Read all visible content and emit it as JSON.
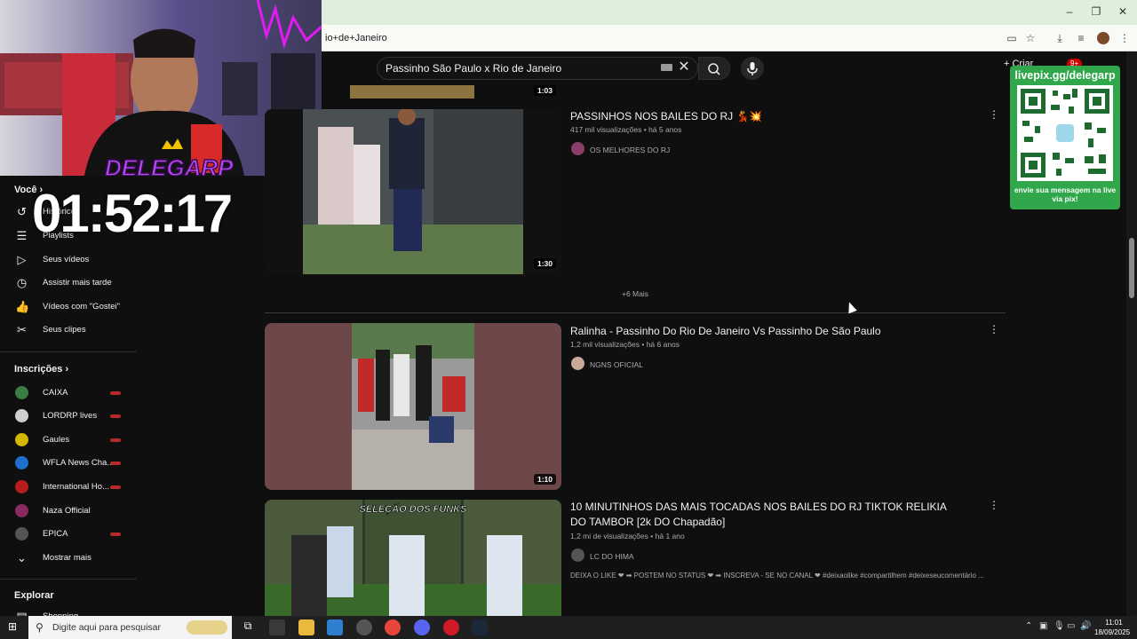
{
  "browser": {
    "url": "io+de+Janeiro",
    "window_controls": {
      "minimize": "–",
      "restore": "❐",
      "close": "✕"
    }
  },
  "youtube": {
    "search_query": "Passinho São Paulo x Rio de Janeiro",
    "create_label": "+ Criar",
    "notification_count": "9+"
  },
  "sidebar": {
    "you_section_title": "Você",
    "you_items": [
      {
        "label": "Histórico",
        "icon": "history-icon"
      },
      {
        "label": "Playlists",
        "icon": "playlists-icon"
      },
      {
        "label": "Seus vídeos",
        "icon": "your-videos-icon"
      },
      {
        "label": "Assistir mais tarde",
        "icon": "watch-later-icon"
      },
      {
        "label": "Vídeos com \"Gostei\"",
        "icon": "like-icon"
      },
      {
        "label": "Seus clipes",
        "icon": "clips-icon"
      }
    ],
    "subscriptions_title": "Inscrições",
    "subscriptions": [
      {
        "label": "CAIXA",
        "color": "#3a7d44"
      },
      {
        "label": "LORDRP lives",
        "color": "#cfcfcf"
      },
      {
        "label": "Gaules",
        "color": "#d4b800"
      },
      {
        "label": "WFLA News Cha...",
        "color": "#1f6fd1"
      },
      {
        "label": "International Ho...",
        "color": "#b81d1d"
      },
      {
        "label": "Naza Official",
        "color": "#8a2a60"
      },
      {
        "label": "EPICA",
        "color": "#555555"
      }
    ],
    "show_more": "Mostrar mais",
    "explore_title": "Explorar",
    "explore_partial": "Shopping"
  },
  "overlay": {
    "timer": "01:52:17",
    "streamer_name": "DELEGARP",
    "pix_url": "livepix.gg/delegarp",
    "pix_message": "envie sua mensagem na live via pix!"
  },
  "results": {
    "top_partial_duration": "1:03",
    "video1": {
      "title": "PASSINHOS NOS BAILES DO RJ 💃💥",
      "views": "417 mil visualizações",
      "age": "há 5 anos",
      "channel": "OS MELHORES DO RJ",
      "duration": "1:30"
    },
    "more_label": "+6 Mais",
    "video2": {
      "title": "Ralinha - Passinho Do Rio De Janeiro Vs Passinho De São Paulo",
      "views": "1,2 mil visualizações",
      "age": "há 6 anos",
      "channel": "NGNS OFICIAL",
      "duration": "1:10"
    },
    "video3": {
      "title": "10 MINUTINHOS DAS MAIS TOCADAS NOS BAILES DO RJ TIKTOK RELIKIA DO TAMBOR [2k DO Chapadão]",
      "views": "1,2 mi de visualizações",
      "age": "há 1 ano",
      "channel": "LC DO HIMA",
      "thumb_text": "SELEÇÃO DOS FUNKS",
      "description": "DEIXA O LIKE ❤ ➡ POSTEM NO STATUS ❤ ➡ INSCREVA - SE NO CANAL ❤ #deixaolike #compartilhem #deixeseucomentário ..."
    },
    "separator": "•"
  },
  "taskbar": {
    "search_placeholder": "Digite aqui para pesquisar",
    "time": "11:01",
    "date": "18/09/2025"
  }
}
